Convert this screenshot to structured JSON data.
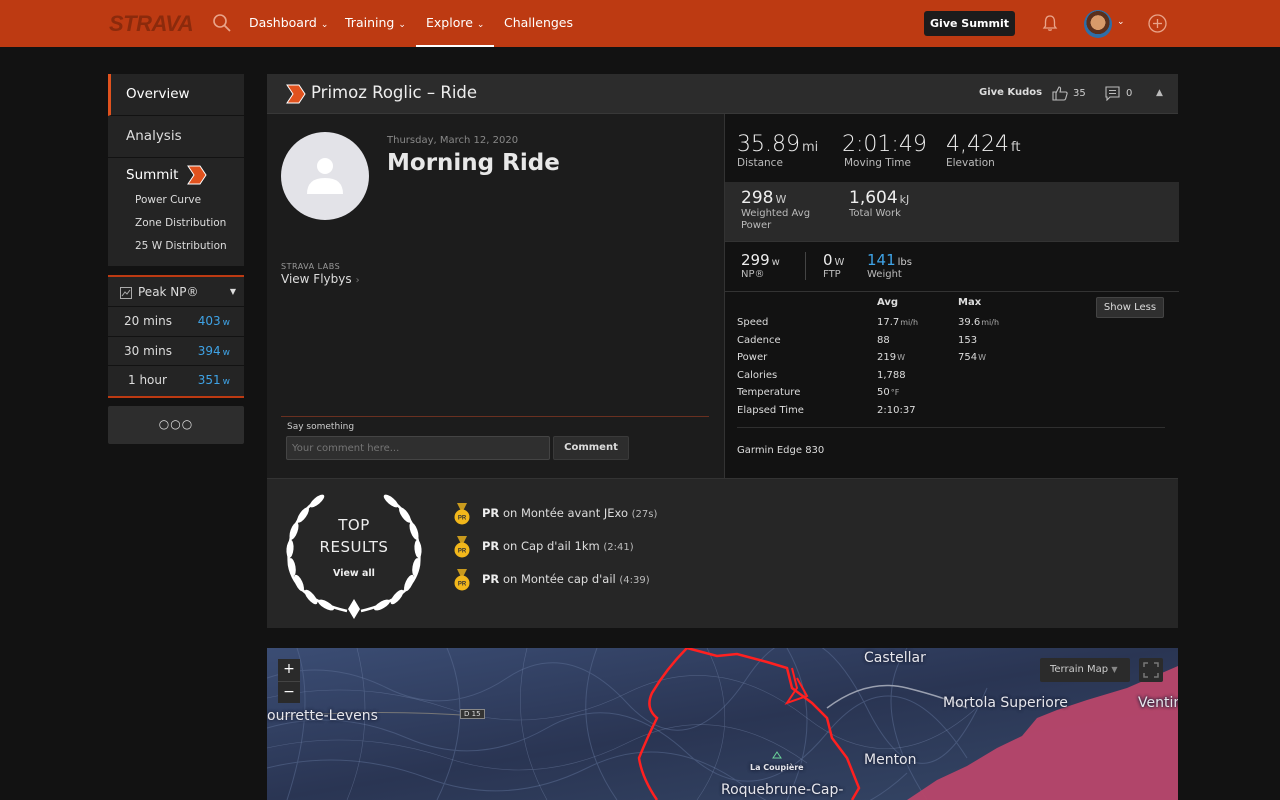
{
  "nav": {
    "logo": "STRAVA",
    "items": [
      {
        "label": "Dashboard"
      },
      {
        "label": "Training"
      },
      {
        "label": "Explore"
      },
      {
        "label": "Challenges"
      }
    ],
    "give_summit": "Give Summit",
    "colors": {
      "brand": "#bd3a12",
      "accent": "#e0521e",
      "link_blue": "#3fa3e6"
    }
  },
  "sidebar": {
    "items": [
      {
        "label": "Overview"
      },
      {
        "label": "Analysis"
      }
    ],
    "summit_label": "Summit",
    "sub_items": [
      "Power Curve",
      "Zone Distribution",
      "25 W Distribution"
    ],
    "peak": {
      "title": "Peak NP®",
      "unit": "w",
      "rows": [
        {
          "duration": "20 mins",
          "value": "403"
        },
        {
          "duration": "30 mins",
          "value": "394"
        },
        {
          "duration": "1 hour",
          "value": "351"
        }
      ]
    },
    "more": "○○○"
  },
  "activity": {
    "athlete_type": "Primoz Roglic – Ride",
    "give_kudos": "Give Kudos",
    "kudos_count": "35",
    "comment_count": "0",
    "date": "Thursday, March 12, 2020",
    "name": "Morning Ride",
    "labs": "STRAVA LABS",
    "flybys": "View Flybys",
    "say_something": "Say something",
    "comment_placeholder": "Your comment here...",
    "comment_button": "Comment"
  },
  "stats": {
    "distance": {
      "value": "35.89",
      "unit": "mi",
      "label": "Distance"
    },
    "moving_time": {
      "value": "2:01:49",
      "label": "Moving Time"
    },
    "elevation": {
      "value": "4,424",
      "unit": "ft",
      "label": "Elevation"
    },
    "weighted_power": {
      "value": "298",
      "unit": "W",
      "label_line1": "Weighted Avg",
      "label_line2": "Power"
    },
    "total_work": {
      "value": "1,604",
      "unit": "kJ",
      "label": "Total Work"
    },
    "np": {
      "value": "299",
      "unit": "w",
      "label": "NP®"
    },
    "ftp": {
      "value": "0",
      "unit": "W",
      "label": "FTP"
    },
    "weight": {
      "value": "141",
      "unit": "lbs",
      "label": "Weight"
    }
  },
  "details_table": {
    "headers": {
      "avg": "Avg",
      "max": "Max"
    },
    "show_less": "Show Less",
    "rows": [
      {
        "label": "Speed",
        "avg": "17.7",
        "avg_unit": "mi/h",
        "max": "39.6",
        "max_unit": "mi/h"
      },
      {
        "label": "Cadence",
        "avg": "88",
        "avg_unit": "",
        "max": "153",
        "max_unit": ""
      },
      {
        "label": "Power",
        "avg": "219",
        "avg_unit": "W",
        "max": "754",
        "max_unit": "W"
      },
      {
        "label": "Calories",
        "avg": "1,788",
        "avg_unit": "",
        "max": "",
        "max_unit": ""
      },
      {
        "label": "Temperature",
        "avg": "50",
        "avg_unit": "°F",
        "max": "",
        "max_unit": ""
      },
      {
        "label": "Elapsed Time",
        "avg": "2:10:37",
        "avg_unit": "",
        "max": "",
        "max_unit": ""
      }
    ],
    "device": "Garmin Edge 830"
  },
  "results": {
    "top_line1": "TOP",
    "top_line2": "RESULTS",
    "view_all": "View all",
    "prs": [
      {
        "badge": "PR",
        "on": "on",
        "segment": "Montée avant JExo",
        "time": "(27s)"
      },
      {
        "badge": "PR",
        "on": "on",
        "segment": "Cap d'ail 1km",
        "time": "(2:41)"
      },
      {
        "badge": "PR",
        "on": "on",
        "segment": "Montée cap d'ail",
        "time": "(4:39)"
      }
    ]
  },
  "map": {
    "zoom_in": "+",
    "zoom_out": "−",
    "terrain": "Terrain Map",
    "labels": {
      "castellar": "Castellar",
      "tourrette": "ourrette-Levens",
      "mortola": "Mortola Superiore",
      "ventimiglia": "Ventim",
      "menton": "Menton",
      "roquebrune": "Roquebrune-Cap-",
      "la_coupiere": "La Coupière",
      "road": "D 15"
    }
  }
}
